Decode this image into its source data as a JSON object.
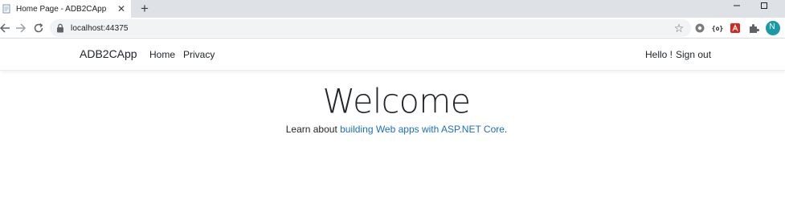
{
  "browser": {
    "tab": {
      "title": "Home Page - ADB2CApp",
      "close_glyph": "✕",
      "favicon": "page-icon"
    },
    "new_tab_glyph": "+",
    "window_controls": {
      "minimize_glyph": "–",
      "maximize": "maximize-icon"
    },
    "address": {
      "url": "localhost:44375",
      "lock_icon": "lock-icon",
      "star_glyph": "☆"
    },
    "extensions": [
      {
        "name": "extension-grey-icon"
      },
      {
        "name": "extension-curly-icon"
      },
      {
        "name": "acrobat-icon",
        "color": "#d9251c"
      },
      {
        "name": "puzzle-icon"
      }
    ],
    "profile_avatar": {
      "letter": "N",
      "color": "#1a9aa6"
    }
  },
  "site": {
    "brand": "ADB2CApp",
    "nav": {
      "home": "Home",
      "privacy": "Privacy",
      "greeting": "Hello !",
      "sign_out": "Sign out"
    },
    "main": {
      "heading": "Welcome",
      "lead_prefix": "Learn about ",
      "lead_link": "building Web apps with ASP.NET Core",
      "lead_suffix": "."
    },
    "colors": {
      "link": "#1b6ec2",
      "text": "#212529"
    }
  }
}
